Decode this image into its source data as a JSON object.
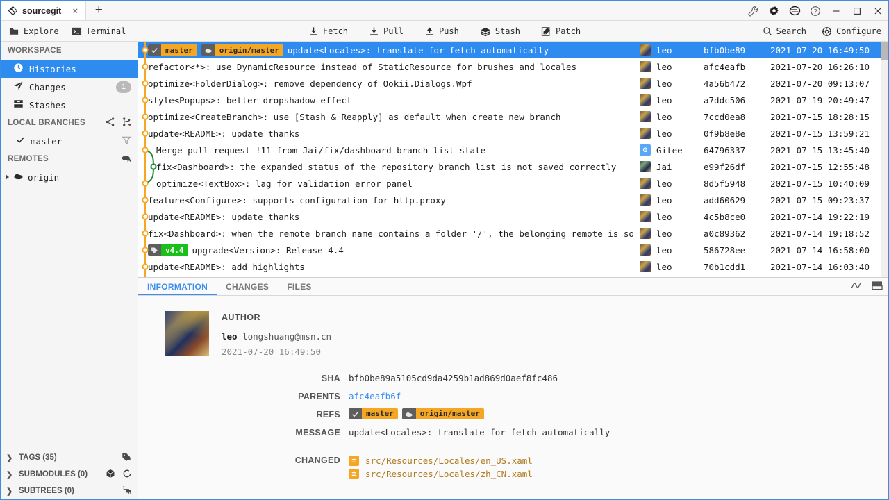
{
  "window": {
    "tab_title": "sourcegit",
    "tab_close": "×",
    "new_tab": "+",
    "controls": [
      "wrench-icon",
      "gear-icon",
      "theme-icon",
      "help-icon",
      "minimize",
      "maximize",
      "close"
    ]
  },
  "toolbar": {
    "left": [
      {
        "label": "Explore",
        "icon": "folder-icon"
      },
      {
        "label": "Terminal",
        "icon": "terminal-icon"
      }
    ],
    "center": [
      {
        "label": "Fetch",
        "icon": "fetch-icon"
      },
      {
        "label": "Pull",
        "icon": "pull-icon"
      },
      {
        "label": "Push",
        "icon": "push-icon"
      },
      {
        "label": "Stash",
        "icon": "stash-icon"
      },
      {
        "label": "Patch",
        "icon": "patch-icon"
      }
    ],
    "right": [
      {
        "label": "Search",
        "icon": "search-icon"
      },
      {
        "label": "Configure",
        "icon": "configure-icon"
      }
    ]
  },
  "sidebar": {
    "workspace_title": "WORKSPACE",
    "workspace": [
      {
        "label": "Histories",
        "icon": "clock-icon",
        "selected": true,
        "badge": ""
      },
      {
        "label": "Changes",
        "icon": "paper-plane-icon",
        "selected": false,
        "badge": "1"
      },
      {
        "label": "Stashes",
        "icon": "drawer-icon",
        "selected": false,
        "badge": ""
      }
    ],
    "local_branches_title": "LOCAL BRANCHES",
    "local_branches": [
      {
        "label": "master",
        "current": true
      }
    ],
    "remotes_title": "REMOTES",
    "remotes": [
      {
        "label": "origin"
      }
    ],
    "bottom": [
      {
        "label": "TAGS (35)",
        "icon": "tag-add-icon"
      },
      {
        "label": "SUBMODULES (0)",
        "icon": "cube-icon"
      },
      {
        "label": "SUBTREES (0)",
        "icon": "subtree-add-icon"
      }
    ]
  },
  "commits": [
    {
      "subject": "update<Locales>: translate for fetch automatically",
      "author": "leo",
      "sha": "bfb0be89",
      "time": "2021-07-20 16:49:50",
      "selected": true,
      "indent": false,
      "avatar": "leo",
      "refs": [
        {
          "type": "branch",
          "icon": "✓",
          "name": "master"
        },
        {
          "type": "remote",
          "icon": "▰",
          "name": "origin/master"
        }
      ]
    },
    {
      "subject": "refactor<*>: use DynamicResource instead of StaticResource for brushes and locales",
      "author": "leo",
      "sha": "afc4eafb",
      "time": "2021-07-20 16:26:10",
      "selected": false,
      "indent": false,
      "avatar": "leo",
      "refs": []
    },
    {
      "subject": "optimize<FolderDialog>: remove dependency of Ookii.Dialogs.Wpf",
      "author": "leo",
      "sha": "4a56b472",
      "time": "2021-07-20 09:13:07",
      "selected": false,
      "indent": false,
      "avatar": "leo",
      "refs": []
    },
    {
      "subject": "style<Popups>: better dropshadow effect",
      "author": "leo",
      "sha": "a7ddc506",
      "time": "2021-07-19 20:49:47",
      "selected": false,
      "indent": false,
      "avatar": "leo",
      "refs": []
    },
    {
      "subject": "optimize<CreateBranch>: use [Stash & Reapply] as default when create new branch",
      "author": "leo",
      "sha": "7ccd0ea8",
      "time": "2021-07-15 18:28:15",
      "selected": false,
      "indent": false,
      "avatar": "leo",
      "refs": []
    },
    {
      "subject": "update<README>: update thanks",
      "author": "leo",
      "sha": "0f9b8e8e",
      "time": "2021-07-15 13:59:21",
      "selected": false,
      "indent": false,
      "avatar": "leo",
      "refs": []
    },
    {
      "subject": "Merge pull request !11 from Jai/fix/dashboard-branch-list-state",
      "author": "Gitee",
      "sha": "64796337",
      "time": "2021-07-15 13:45:40",
      "selected": false,
      "indent": true,
      "avatar": "gitee",
      "refs": []
    },
    {
      "subject": "fix<Dashboard>: the expanded status of the repository branch list is not saved correctly",
      "author": "Jai",
      "sha": "e99f26df",
      "time": "2021-07-15 12:55:48",
      "selected": false,
      "indent": true,
      "avatar": "jai",
      "refs": []
    },
    {
      "subject": "optimize<TextBox>: lag for validation error panel",
      "author": "leo",
      "sha": "8d5f5948",
      "time": "2021-07-15 10:40:09",
      "selected": false,
      "indent": true,
      "avatar": "leo",
      "refs": []
    },
    {
      "subject": "feature<Configure>: supports configuration for http.proxy",
      "author": "leo",
      "sha": "add60629",
      "time": "2021-07-15 09:23:37",
      "selected": false,
      "indent": false,
      "avatar": "leo",
      "refs": []
    },
    {
      "subject": "update<README>: update thanks",
      "author": "leo",
      "sha": "4c5b8ce0",
      "time": "2021-07-14 19:22:19",
      "selected": false,
      "indent": false,
      "avatar": "leo",
      "refs": []
    },
    {
      "subject": "fix<Dashboard>: when the remote branch name contains a folder '/', the belonging remote is sometimes incorrect",
      "author": "leo",
      "sha": "a0c89362",
      "time": "2021-07-14 19:18:52",
      "selected": false,
      "indent": false,
      "avatar": "leo",
      "refs": []
    },
    {
      "subject": "upgrade<Version>: Release 4.4",
      "author": "leo",
      "sha": "586728ee",
      "time": "2021-07-14 16:58:00",
      "selected": false,
      "indent": false,
      "avatar": "leo",
      "refs": [
        {
          "type": "tag",
          "icon": "⬢",
          "name": "v4.4"
        }
      ]
    },
    {
      "subject": "update<README>: add highlights",
      "author": "leo",
      "sha": "70b1cdd1",
      "time": "2021-07-14 16:03:40",
      "selected": false,
      "indent": false,
      "avatar": "leo",
      "refs": []
    }
  ],
  "info": {
    "tabs": [
      {
        "label": "INFORMATION",
        "active": true
      },
      {
        "label": "CHANGES",
        "active": false
      },
      {
        "label": "FILES",
        "active": false
      }
    ],
    "tools": [
      "graph-icon",
      "layout-icon"
    ],
    "author_label": "AUTHOR",
    "author_name": "leo",
    "author_email": "longshuang@msn.cn",
    "author_time": "2021-07-20 16:49:50",
    "fields": {
      "sha_label": "SHA",
      "sha_value": "bfb0be89a5105cd9da4259b1ad869d0aef8fc486",
      "parents_label": "PARENTS",
      "parents_value": "afc4eafb6f",
      "refs_label": "REFS",
      "refs": [
        {
          "type": "branch",
          "icon": "✓",
          "name": "master"
        },
        {
          "type": "remote",
          "icon": "▰",
          "name": "origin/master"
        }
      ],
      "message_label": "MESSAGE",
      "message_value": "update<Locales>: translate for fetch automatically",
      "changed_label": "CHANGED",
      "changed_files": [
        {
          "status": "±",
          "path": "src/Resources/Locales/en_US.xaml"
        },
        {
          "status": "±",
          "path": "src/Resources/Locales/zh_CN.xaml"
        }
      ]
    }
  },
  "colors": {
    "accent": "#2e8bf0",
    "graph_main": "#f5a623",
    "graph_branch": "#1e8a32",
    "tag_green": "#1bbf1b",
    "ref_orange": "#f5a623"
  }
}
